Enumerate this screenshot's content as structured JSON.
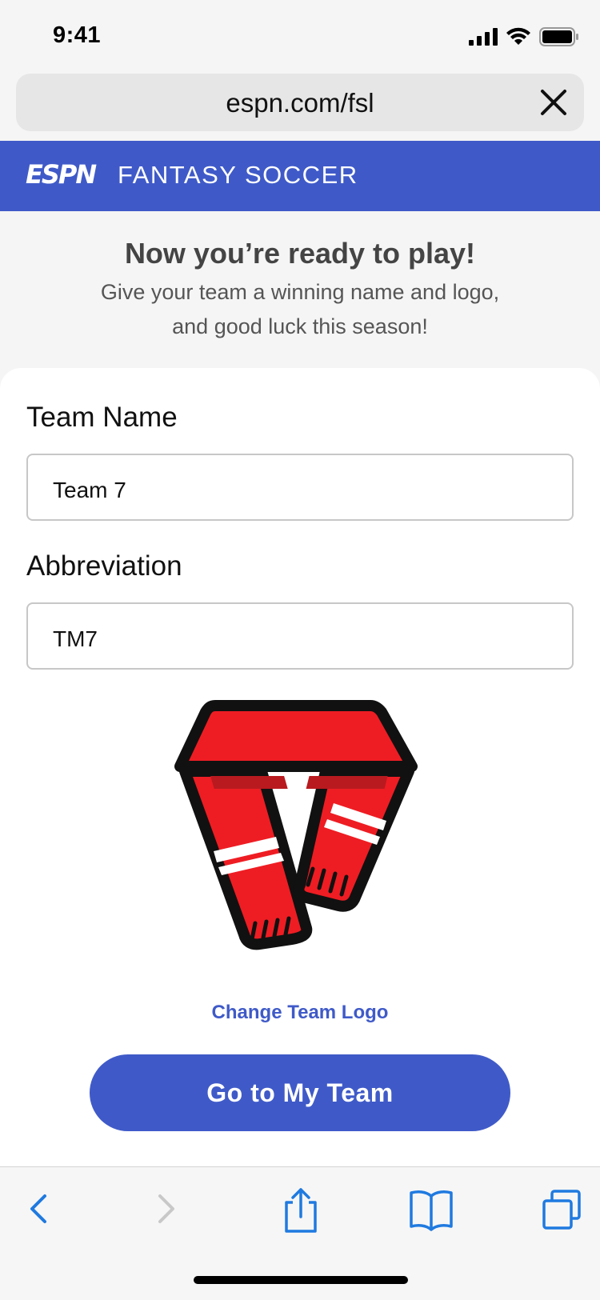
{
  "status": {
    "time": "9:41"
  },
  "browser": {
    "url": "espn.com/fsl"
  },
  "header": {
    "logo_text": "ESPN",
    "title": "FANTASY SOCCER"
  },
  "intro": {
    "heading": "Now you’re ready to play!",
    "subtext": "Give your team a winning name and logo, and good luck this season!"
  },
  "form": {
    "team_name": {
      "label": "Team Name",
      "value": "Team 7"
    },
    "abbreviation": {
      "label": "Abbreviation",
      "value": "TM7"
    }
  },
  "logo": {
    "icon": "scarf-icon",
    "change_label": "Change Team Logo"
  },
  "primary_button": {
    "label": "Go to My Team"
  },
  "toolbar": {
    "items": [
      "back-icon",
      "forward-icon",
      "share-icon",
      "bookmarks-icon",
      "tabs-icon"
    ]
  },
  "colors": {
    "brand": "#3f5ac8",
    "scarf_red": "#ee1d23",
    "scarf_dark": "#111111"
  }
}
